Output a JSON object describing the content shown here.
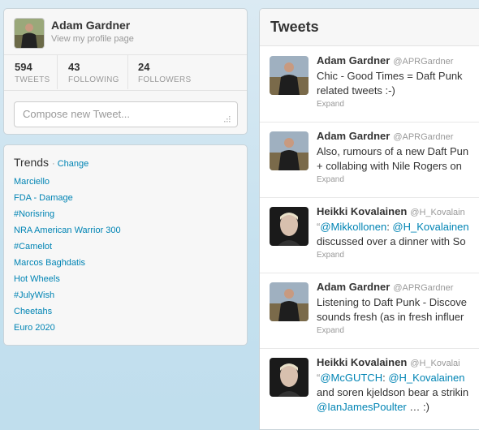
{
  "profile": {
    "name": "Adam Gardner",
    "link": "View my profile page",
    "stats": [
      {
        "value": "594",
        "label": "TWEETS"
      },
      {
        "value": "43",
        "label": "FOLLOWING"
      },
      {
        "value": "24",
        "label": "FOLLOWERS"
      }
    ],
    "compose_placeholder": "Compose new Tweet..."
  },
  "trends": {
    "title": "Trends",
    "change": "Change",
    "items": [
      "Marciello",
      "FDA - Damage",
      "#Norisring",
      "NRA American Warrior 300",
      "#Camelot",
      "Marcos Baghdatis",
      "Hot Wheels",
      "#JulyWish",
      "Cheetahs",
      "Euro 2020"
    ]
  },
  "tweets": {
    "title": "Tweets",
    "expand": "Expand",
    "items": [
      {
        "name": "Adam Gardner",
        "handle": "@APRGardner",
        "line1": "Chic - Good Times = Daft Punk",
        "line2": "related tweets :-)",
        "avatar": "adam"
      },
      {
        "name": "Adam Gardner",
        "handle": "@APRGardner",
        "line1": "Also, rumours of a new Daft Pun",
        "line2": "+ collabing with Nile Rogers on",
        "avatar": "adam"
      },
      {
        "name": "Heikki Kovalainen",
        "handle": "@H_Kovalain",
        "line1_mention1": "@Mikkollonen",
        "line1_sep": ": ",
        "line1_mention2": "@H_Kovalainen",
        "line2": "discussed over a dinner with So",
        "avatar": "heikki"
      },
      {
        "name": "Adam Gardner",
        "handle": "@APRGardner",
        "line1": "Listening to Daft Punk - Discove",
        "line2": "sounds fresh (as in fresh influer",
        "avatar": "adam"
      },
      {
        "name": "Heikki Kovalainen",
        "handle": "@H_Kovalai",
        "line1_mention1": "@McGUTCH",
        "line1_sep": ": ",
        "line1_mention2": "@H_Kovalainen",
        "line2": "and soren kjeldson bear a strikin",
        "line3_mention": "@IanJamesPoulter",
        "line3_rest": " … :)",
        "avatar": "heikki"
      }
    ]
  },
  "colors": {
    "link": "#0084b4",
    "background": "#c0deed"
  }
}
